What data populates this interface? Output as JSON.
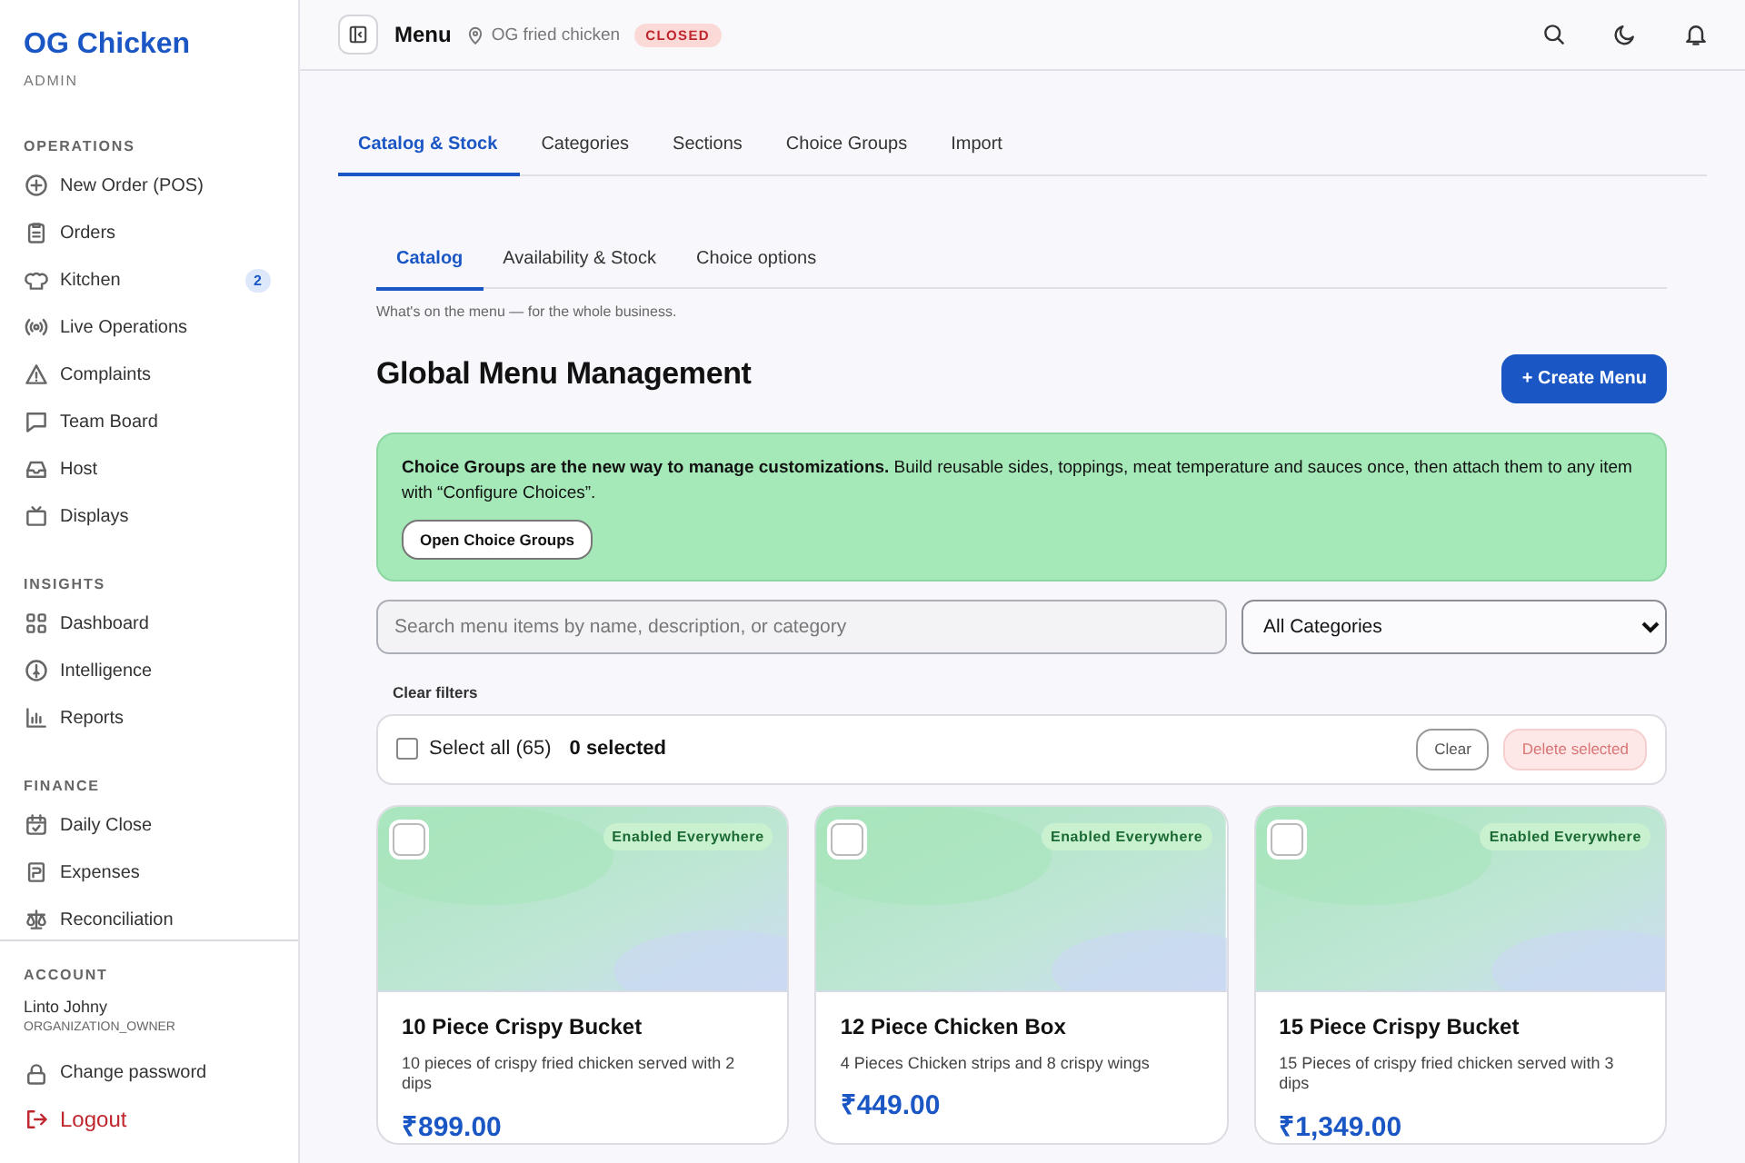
{
  "sidebar": {
    "brand": "OG Chicken",
    "role": "ADMIN",
    "sections": [
      {
        "heading": "OPERATIONS",
        "items": [
          {
            "label": "New Order (POS)"
          },
          {
            "label": "Orders"
          },
          {
            "label": "Kitchen",
            "badge": "2"
          },
          {
            "label": "Live Operations"
          },
          {
            "label": "Complaints"
          },
          {
            "label": "Team Board"
          },
          {
            "label": "Host"
          },
          {
            "label": "Displays"
          }
        ]
      },
      {
        "heading": "INSIGHTS",
        "items": [
          {
            "label": "Dashboard"
          },
          {
            "label": "Intelligence"
          },
          {
            "label": "Reports"
          }
        ]
      },
      {
        "heading": "FINANCE",
        "items": [
          {
            "label": "Daily Close"
          },
          {
            "label": "Expenses"
          },
          {
            "label": "Reconciliation"
          }
        ]
      }
    ],
    "account": {
      "heading": "ACCOUNT",
      "user": "Linto Johny",
      "user_role": "ORGANIZATION_OWNER",
      "items": [
        {
          "label": "Change password",
          "kind": "normal"
        },
        {
          "label": "Logout",
          "kind": "danger"
        }
      ]
    }
  },
  "topbar": {
    "title": "Menu",
    "location": "OG fried chicken",
    "status": "CLOSED"
  },
  "tabs": [
    {
      "label": "Catalog & Stock",
      "selected": true
    },
    {
      "label": "Categories",
      "selected": false
    },
    {
      "label": "Sections",
      "selected": false
    },
    {
      "label": "Choice Groups",
      "selected": false
    },
    {
      "label": "Import",
      "selected": false
    }
  ],
  "subtabs": [
    {
      "label": "Catalog",
      "selected": true
    },
    {
      "label": "Availability & Stock",
      "selected": false
    },
    {
      "label": "Choice options",
      "selected": false
    }
  ],
  "caption": "What's on the menu — for the whole business.",
  "heading": "Global Menu Management",
  "create_button": "+ Create Menu",
  "banner": {
    "text": "**Choice Groups are the new way to manage customizations.** Build reusable sides, toppings, meat temperature and sauces once, then attach them to any item with “Configure Choices”.",
    "button": "Open Choice Groups"
  },
  "search": {
    "placeholder": "Search menu items by name, description, or category"
  },
  "category_select": {
    "value": "All Categories"
  },
  "clear_filters": "Clear filters",
  "selection": {
    "checked": false,
    "label": "Select all (65)",
    "count": "0 selected",
    "clear": "Clear",
    "delete": "Delete selected",
    "delete_disabled": true
  },
  "items": [
    {
      "checked": false,
      "badge": "Enabled Everywhere",
      "name": "10 Piece Crispy Bucket",
      "description": "10 pieces of crispy fried chicken served with 2 dips",
      "price": "₹899.00"
    },
    {
      "checked": false,
      "badge": "Enabled Everywhere",
      "name": "12 Piece Chicken Box",
      "description": "4 Pieces Chicken strips and 8 crispy wings",
      "price": "₹449.00"
    },
    {
      "checked": false,
      "badge": "Enabled Everywhere",
      "name": "15 Piece Crispy Bucket",
      "description": "15 Pieces of crispy fried chicken served with 3 dips",
      "price": "₹1,349.00"
    }
  ]
}
